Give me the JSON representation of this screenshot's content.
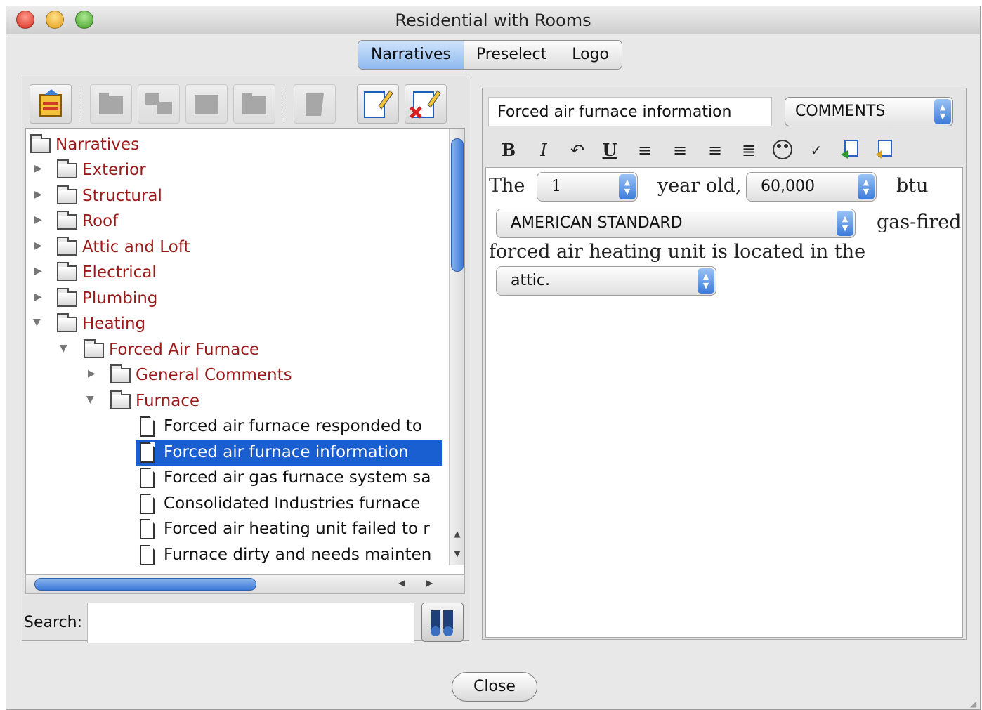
{
  "window": {
    "title": "Residential with Rooms"
  },
  "tabs": [
    {
      "label": "Narratives",
      "active": true
    },
    {
      "label": "Preselect",
      "active": false
    },
    {
      "label": "Logo",
      "active": false
    }
  ],
  "toolbar": {
    "icons": [
      "open-folder-icon",
      "new-folder-icon",
      "move-folder-icon",
      "folder-icon",
      "folder-up-icon",
      "delete-gray-icon",
      "edit-item-icon",
      "delete-item-icon"
    ]
  },
  "tree": {
    "root": "Narratives",
    "items": [
      {
        "label": "Exterior"
      },
      {
        "label": "Structural"
      },
      {
        "label": "Roof"
      },
      {
        "label": "Attic and Loft"
      },
      {
        "label": "Electrical"
      },
      {
        "label": "Plumbing"
      },
      {
        "label": "Heating"
      },
      {
        "label": "Forced Air Furnace"
      },
      {
        "label": "General Comments"
      },
      {
        "label": "Furnace"
      }
    ],
    "docs": [
      {
        "label": "Forced air furnace responded to"
      },
      {
        "label": "Forced air furnace information"
      },
      {
        "label": "Forced air gas furnace system sa"
      },
      {
        "label": "Consolidated Industries furnace"
      },
      {
        "label": "Forced air heating unit failed to r"
      },
      {
        "label": "Furnace dirty and needs mainten"
      }
    ],
    "selected": "Forced air furnace information"
  },
  "search": {
    "label": "Search:",
    "value": ""
  },
  "editor": {
    "title": "Forced air furnace information",
    "category": "COMMENTS",
    "formatting": [
      "bold-icon",
      "italic-icon",
      "undo-icon",
      "underline-icon",
      "align-left-icon",
      "align-center-icon",
      "align-right-icon",
      "justify-icon",
      "paint-palette-icon",
      "spellcheck-icon",
      "import-icon",
      "export-icon"
    ],
    "text": {
      "the": "The",
      "age": "1",
      "year_old": "year old,",
      "btu_value": "60,000",
      "btu": "btu",
      "brand": "AMERICAN STANDARD",
      "fuel": "gas-fired",
      "located": "forced air heating unit is located in the",
      "location": "attic."
    }
  },
  "close_label": "Close",
  "colors": {
    "accent": "#1a5fd1",
    "folder_text": "#9a1a1a"
  }
}
